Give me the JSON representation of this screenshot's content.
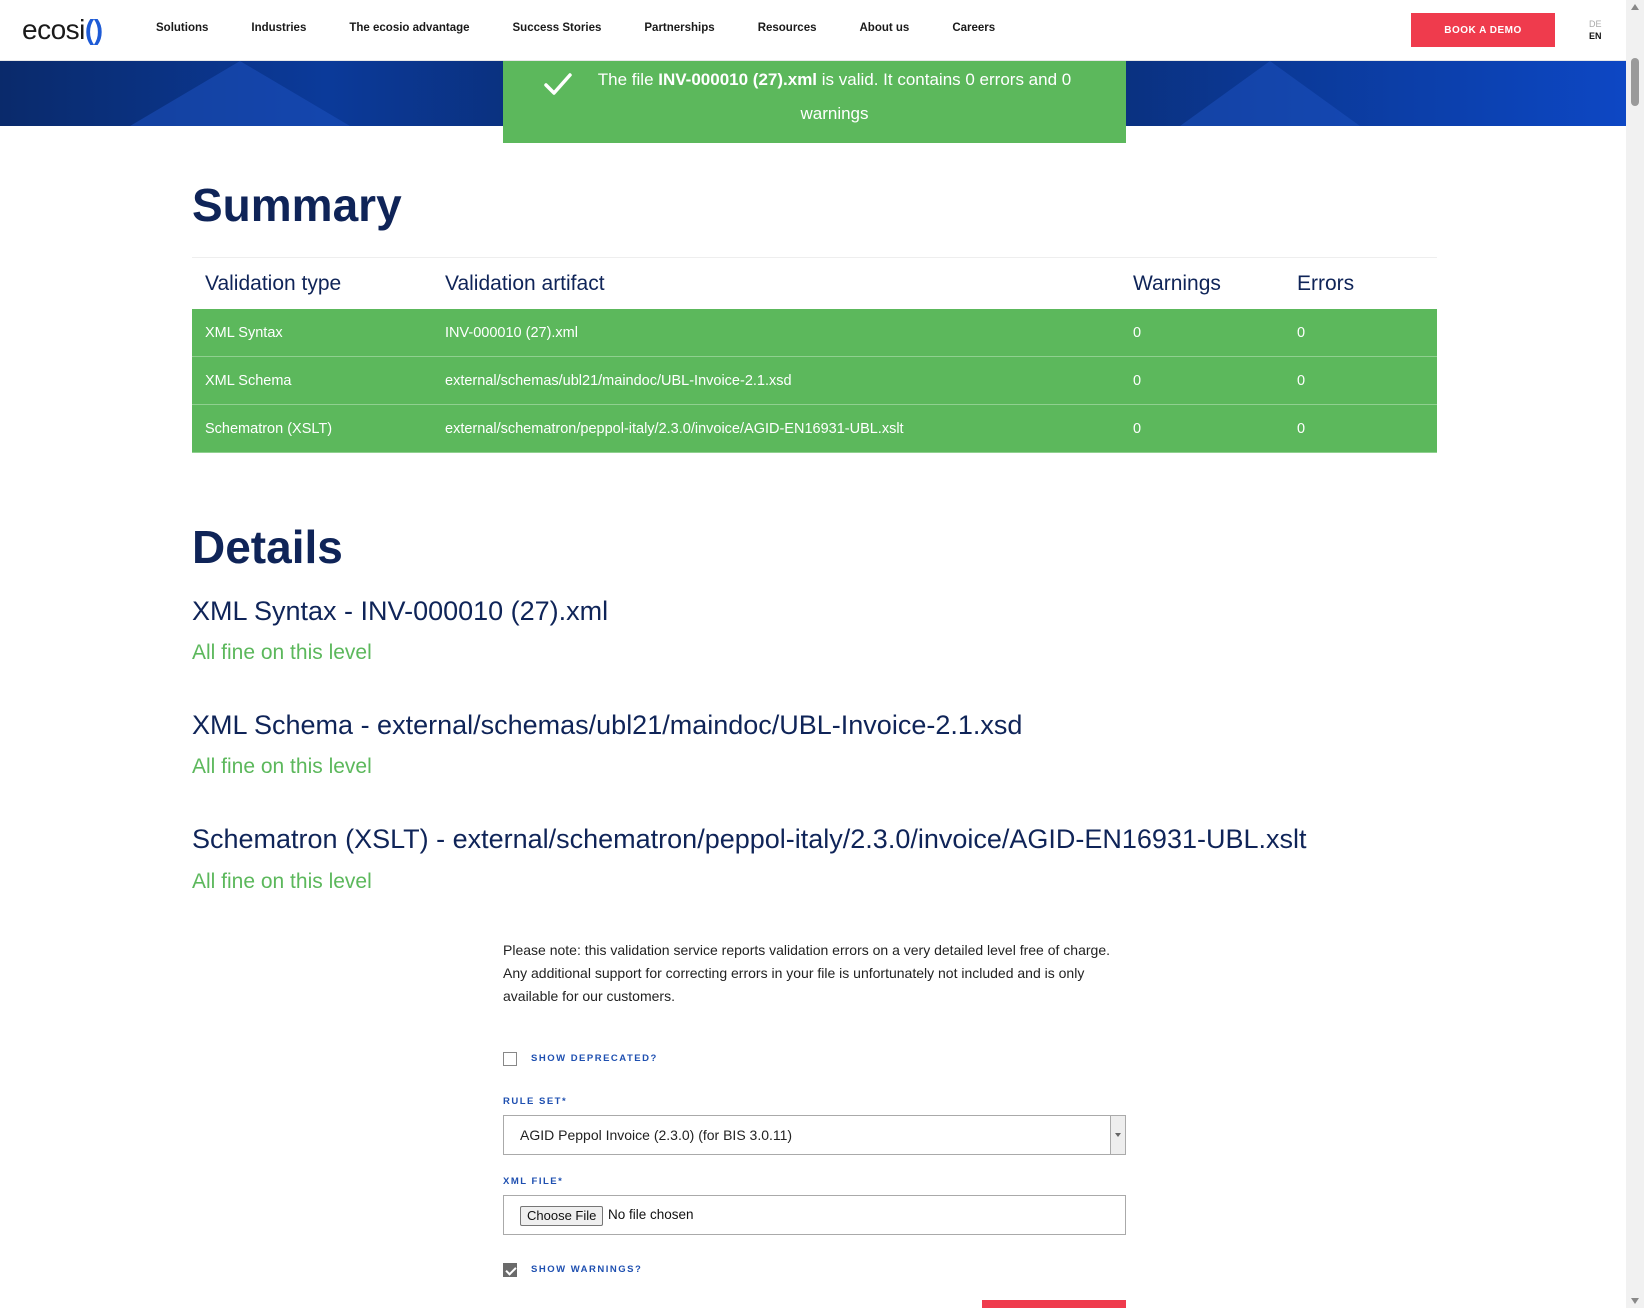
{
  "header": {
    "logo": "ecosi",
    "logo_paren": "( )",
    "nav": [
      "Solutions",
      "Industries",
      "The ecosio advantage",
      "Success Stories",
      "Partnerships",
      "Resources",
      "About us",
      "Careers"
    ],
    "demo_button": "BOOK A DEMO",
    "lang_de": "DE",
    "lang_en": "EN"
  },
  "banner": {
    "prefix": "The file ",
    "filename": "INV-000010 (27).xml",
    "suffix": " is valid. It contains 0 errors and 0 warnings"
  },
  "summary": {
    "title": "Summary",
    "columns": [
      "Validation type",
      "Validation artifact",
      "Warnings",
      "Errors"
    ],
    "rows": [
      [
        "XML Syntax",
        "INV-000010 (27).xml",
        "0",
        "0"
      ],
      [
        "XML Schema",
        "external/schemas/ubl21/maindoc/UBL-Invoice-2.1.xsd",
        "0",
        "0"
      ],
      [
        "Schematron (XSLT)",
        "external/schematron/peppol-italy/2.3.0/invoice/AGID-EN16931-UBL.xslt",
        "0",
        "0"
      ]
    ]
  },
  "details": {
    "title": "Details",
    "items": [
      {
        "title": "XML Syntax - INV-000010 (27).xml",
        "status": "All fine on this level"
      },
      {
        "title": "XML Schema - external/schemas/ubl21/maindoc/UBL-Invoice-2.1.xsd",
        "status": "All fine on this level"
      },
      {
        "title": "Schematron (XSLT) - external/schematron/peppol-italy/2.3.0/invoice/AGID-EN16931-UBL.xslt",
        "status": "All fine on this level"
      }
    ]
  },
  "note": "Please note: this validation service reports validation errors on a very detailed level free of charge. Any additional support for correcting errors in your file is unfortunately not included and is only available for our customers.",
  "form": {
    "show_deprecated_label": "SHOW DEPRECATED?",
    "show_deprecated_checked": false,
    "rule_set_label": "RULE SET*",
    "rule_set_value": "AGID Peppol Invoice (2.3.0) (for BIS 3.0.11)",
    "xml_file_label": "XML FILE*",
    "choose_file": "Choose File",
    "no_file": "No file chosen",
    "show_warnings_label": "SHOW WARNINGS?",
    "show_warnings_checked": true
  },
  "colors": {
    "accent_red": "#ef3b4d",
    "success_green": "#5cb85c",
    "navy": "#0f2458",
    "brand_blue": "#1e5bd6"
  }
}
